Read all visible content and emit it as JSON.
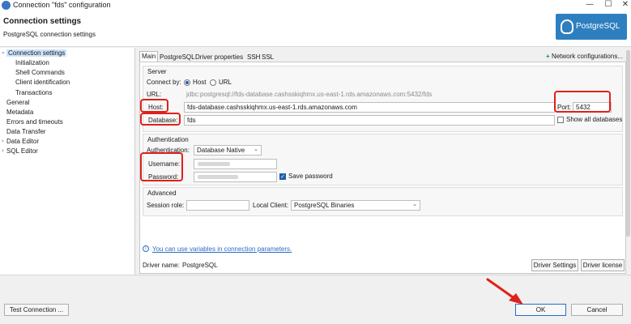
{
  "window": {
    "title": "Connection \"fds\" configuration",
    "minimize": "—",
    "maximize": "☐",
    "close": "✕"
  },
  "header": {
    "title": "Connection settings",
    "subtitle": "PostgreSQL connection settings",
    "logo_text": "PostgreSQL"
  },
  "sidebar": {
    "items": [
      {
        "label": "Connection settings",
        "arrow": "⌄"
      },
      {
        "label": "Initialization"
      },
      {
        "label": "Shell Commands"
      },
      {
        "label": "Client identification"
      },
      {
        "label": "Transactions"
      },
      {
        "label": "General"
      },
      {
        "label": "Metadata"
      },
      {
        "label": "Errors and timeouts"
      },
      {
        "label": "Data Transfer"
      },
      {
        "label": "Data Editor",
        "arrow": "›"
      },
      {
        "label": "SQL Editor",
        "arrow": "›"
      }
    ]
  },
  "tabs": [
    "Main",
    "PostgreSQL",
    "Driver properties",
    "SSH",
    "SSL"
  ],
  "network": {
    "plus": "+",
    "label": "Network configurations..."
  },
  "server": {
    "title": "Server",
    "connect_by_label": "Connect by:",
    "host_option": "Host",
    "url_option": "URL",
    "url_label": "URL:",
    "url_value": "jdbc:postgresql://fds-database.cashsskiqhmx.us-east-1.rds.amazonaws.com:5432/fds",
    "host_label": "Host:",
    "host_value": "fds-database.cashsskiqhmx.us-east-1.rds.amazonaws.com",
    "port_label": "Port:",
    "port_value": "5432",
    "database_label": "Database:",
    "database_value": "fds",
    "show_all_label": "Show all databases"
  },
  "authentication": {
    "title": "Authentication",
    "auth_label": "Authentication:",
    "auth_value": "Database Native",
    "username_label": "Username:",
    "password_label": "Password:",
    "save_password_label": "Save password",
    "save_password_check": "✓"
  },
  "advanced": {
    "title": "Advanced",
    "session_role_label": "Session role:",
    "local_client_label": "Local Client:",
    "local_client_value": "PostgreSQL Binaries"
  },
  "info": {
    "icon": "i",
    "text": "You can use variables in connection parameters."
  },
  "driver": {
    "label": "Driver name:",
    "value": "PostgreSQL",
    "settings_button": "Driver Settings",
    "license_button": "Driver license"
  },
  "footer": {
    "test_button": "Test Connection ...",
    "ok_button": "OK",
    "cancel_button": "Cancel"
  },
  "colors": {
    "highlight": "#e0201c",
    "accent": "#2b6cc4",
    "logo_bg": "#2d7fbf"
  }
}
